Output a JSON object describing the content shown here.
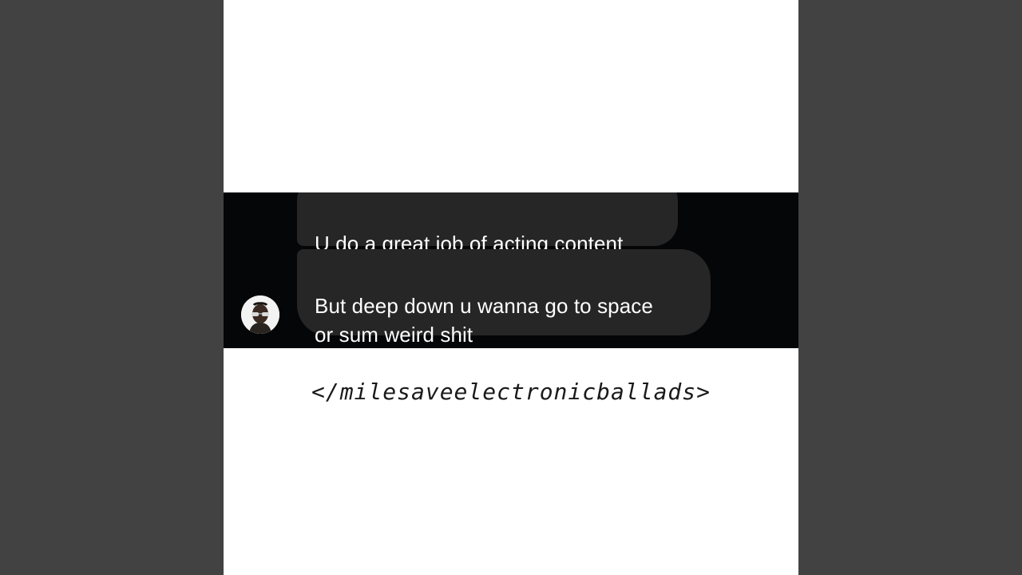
{
  "chat": {
    "messages": [
      {
        "text": "U do a great job of acting content"
      },
      {
        "text": "But deep down u wanna go to space\nor sum weird shit"
      }
    ]
  },
  "footer": {
    "text": "</milesaveelectronicballads>"
  },
  "colors": {
    "background_bars": "#424242",
    "cover": "#ffffff",
    "chat_band": "#050607",
    "bubble": "#262626",
    "bubble_text": "#ffffff"
  }
}
